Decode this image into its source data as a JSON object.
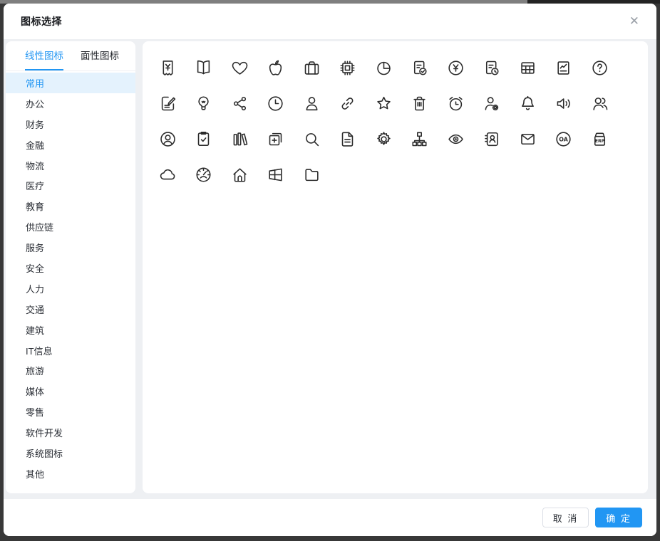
{
  "dialog": {
    "title": "图标选择",
    "close_glyph": "✕"
  },
  "tabs": [
    {
      "label": "线性图标",
      "active": true
    },
    {
      "label": "面性图标",
      "active": false
    }
  ],
  "sidebar": {
    "categories": [
      {
        "label": "常用",
        "selected": true
      },
      {
        "label": "办公",
        "selected": false
      },
      {
        "label": "财务",
        "selected": false
      },
      {
        "label": "金融",
        "selected": false
      },
      {
        "label": "物流",
        "selected": false
      },
      {
        "label": "医疗",
        "selected": false
      },
      {
        "label": "教育",
        "selected": false
      },
      {
        "label": "供应链",
        "selected": false
      },
      {
        "label": "服务",
        "selected": false
      },
      {
        "label": "安全",
        "selected": false
      },
      {
        "label": "人力",
        "selected": false
      },
      {
        "label": "交通",
        "selected": false
      },
      {
        "label": "建筑",
        "selected": false
      },
      {
        "label": "IT信息",
        "selected": false
      },
      {
        "label": "旅游",
        "selected": false
      },
      {
        "label": "媒体",
        "selected": false
      },
      {
        "label": "零售",
        "selected": false
      },
      {
        "label": "软件开发",
        "selected": false
      },
      {
        "label": "系统图标",
        "selected": false
      },
      {
        "label": "其他",
        "selected": false
      }
    ]
  },
  "icon_grid": {
    "icons": [
      "receipt-yen",
      "book-open",
      "heart",
      "apple-logo",
      "briefcase",
      "cpu-chip",
      "pie-chart",
      "document-check",
      "yen-circle",
      "document-clock",
      "table-grid",
      "report-chart",
      "question-circle",
      "document-edit",
      "light-bulb",
      "share-nodes",
      "clock",
      "user",
      "link",
      "star",
      "trash",
      "alarm-clock",
      "user-gear",
      "bell",
      "speaker",
      "users-group",
      "user-circle",
      "clipboard-check",
      "books",
      "add-square",
      "search",
      "document",
      "gear",
      "org-chart",
      "eye",
      "id-card",
      "envelope",
      "oa-circle",
      "erp-box",
      "cloud",
      "gauge",
      "home",
      "windows-logo",
      "folder"
    ],
    "icon_text": {
      "oa": "OA",
      "erp": "ERP"
    }
  },
  "footer": {
    "cancel_label": "取 消",
    "confirm_label": "确 定"
  },
  "colors": {
    "accent": "#2196f3",
    "accent_light_bg": "#e4f2fd",
    "icon_stroke": "#2b2b2b",
    "content_bg": "#eef0f3",
    "backdrop": "#383838"
  }
}
